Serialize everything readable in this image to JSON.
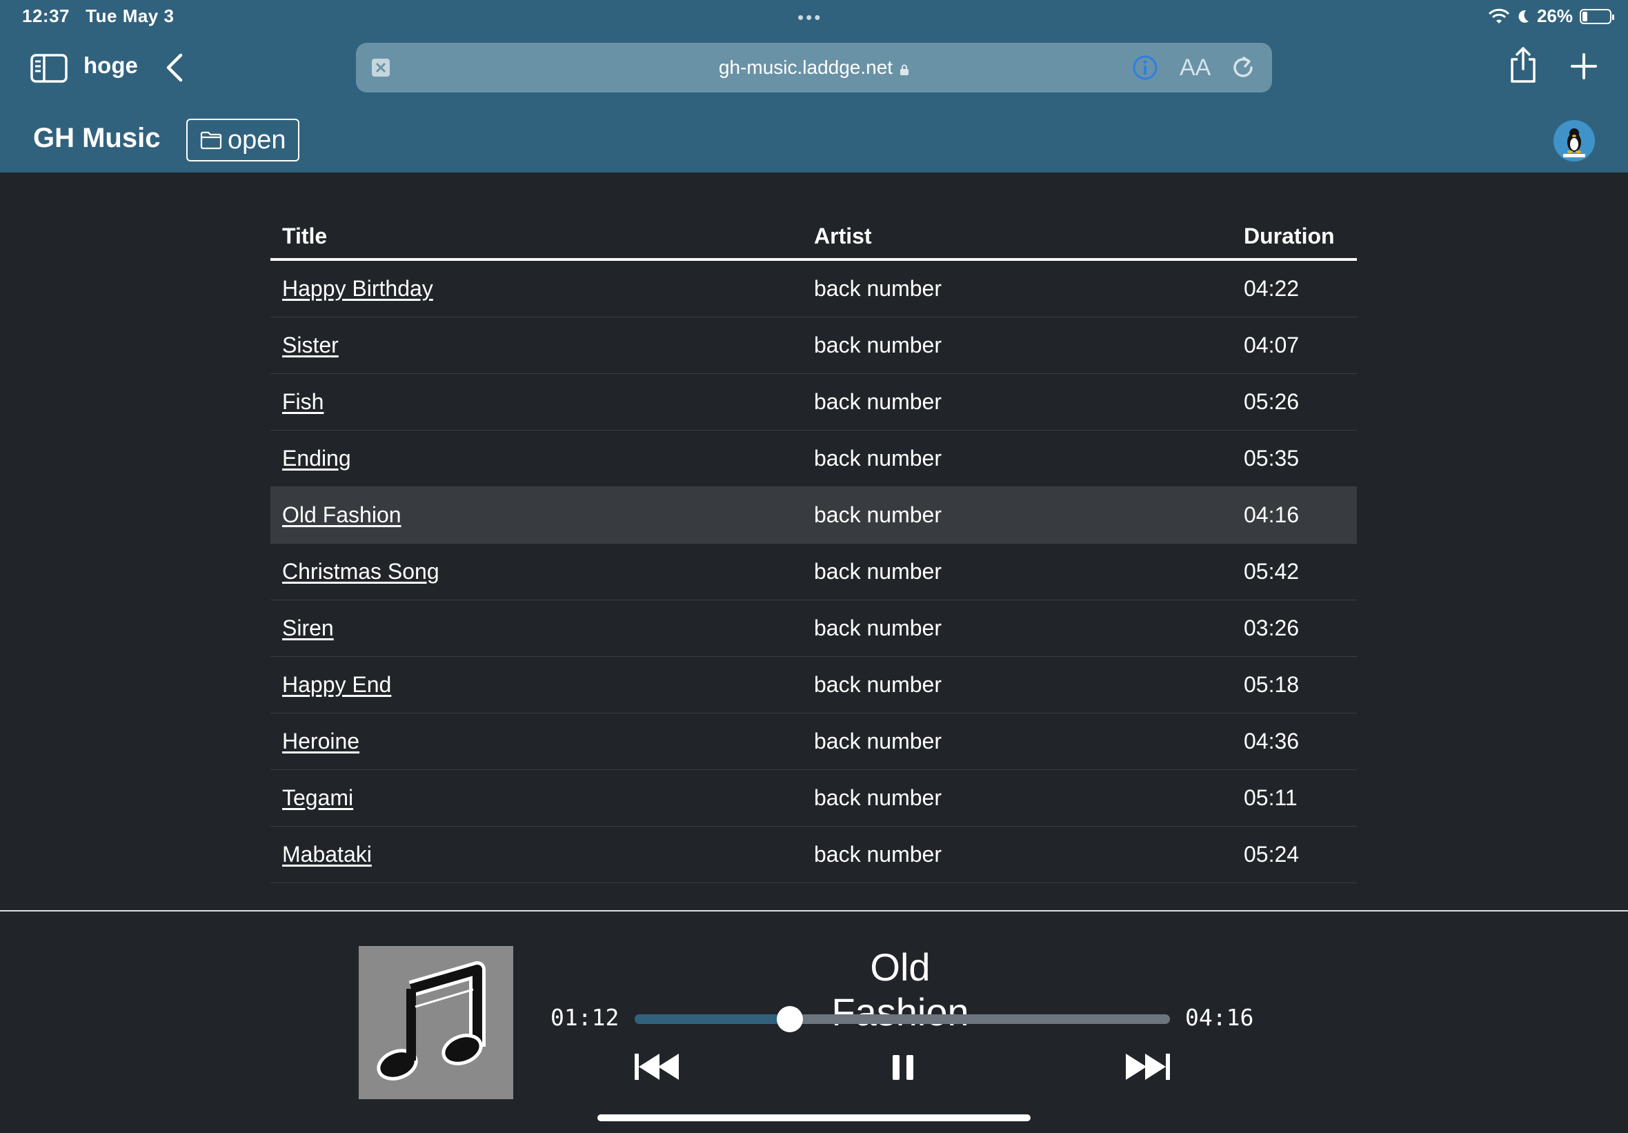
{
  "status_bar": {
    "time": "12:37",
    "date": "Tue May 3",
    "battery": "26%",
    "battery_level": 0.26
  },
  "browser": {
    "tab_name": "hoge",
    "url": "gh-music.laddge.net",
    "text_size_label": "AA"
  },
  "app": {
    "title": "GH Music",
    "open_label": "open"
  },
  "table": {
    "headers": [
      "Title",
      "Artist",
      "Duration"
    ],
    "rows": [
      {
        "title": "Happy Birthday",
        "artist": "back number",
        "duration": "04:22"
      },
      {
        "title": "Sister",
        "artist": "back number",
        "duration": "04:07"
      },
      {
        "title": "Fish",
        "artist": "back number",
        "duration": "05:26"
      },
      {
        "title": "Ending",
        "artist": "back number",
        "duration": "05:35"
      },
      {
        "title": "Old Fashion",
        "artist": "back number",
        "duration": "04:16"
      },
      {
        "title": "Christmas Song",
        "artist": "back number",
        "duration": "05:42"
      },
      {
        "title": "Siren",
        "artist": "back number",
        "duration": "03:26"
      },
      {
        "title": "Happy End",
        "artist": "back number",
        "duration": "05:18"
      },
      {
        "title": "Heroine",
        "artist": "back number",
        "duration": "04:36"
      },
      {
        "title": "Tegami",
        "artist": "back number",
        "duration": "05:11"
      },
      {
        "title": "Mabataki",
        "artist": "back number",
        "duration": "05:24"
      }
    ]
  },
  "player": {
    "title": "Old Fashion",
    "current_time": "01:12",
    "duration": "04:16",
    "progress": 0.29
  },
  "colors": {
    "header_bg": "#31627d",
    "body_bg": "#212529",
    "active_row": "#383b3f",
    "accent": "#31627d"
  },
  "icons": {
    "sidebar": "sidebar-icon",
    "back": "chevron-left-icon",
    "stop": "stop-loading-icon",
    "lock": "lock-icon",
    "info": "info-icon",
    "reload": "reload-icon",
    "share": "share-icon",
    "add": "plus-icon",
    "folder": "folder-icon",
    "prev": "previous-track-icon",
    "pause": "pause-icon",
    "next": "next-track-icon",
    "music": "music-note-icon"
  }
}
